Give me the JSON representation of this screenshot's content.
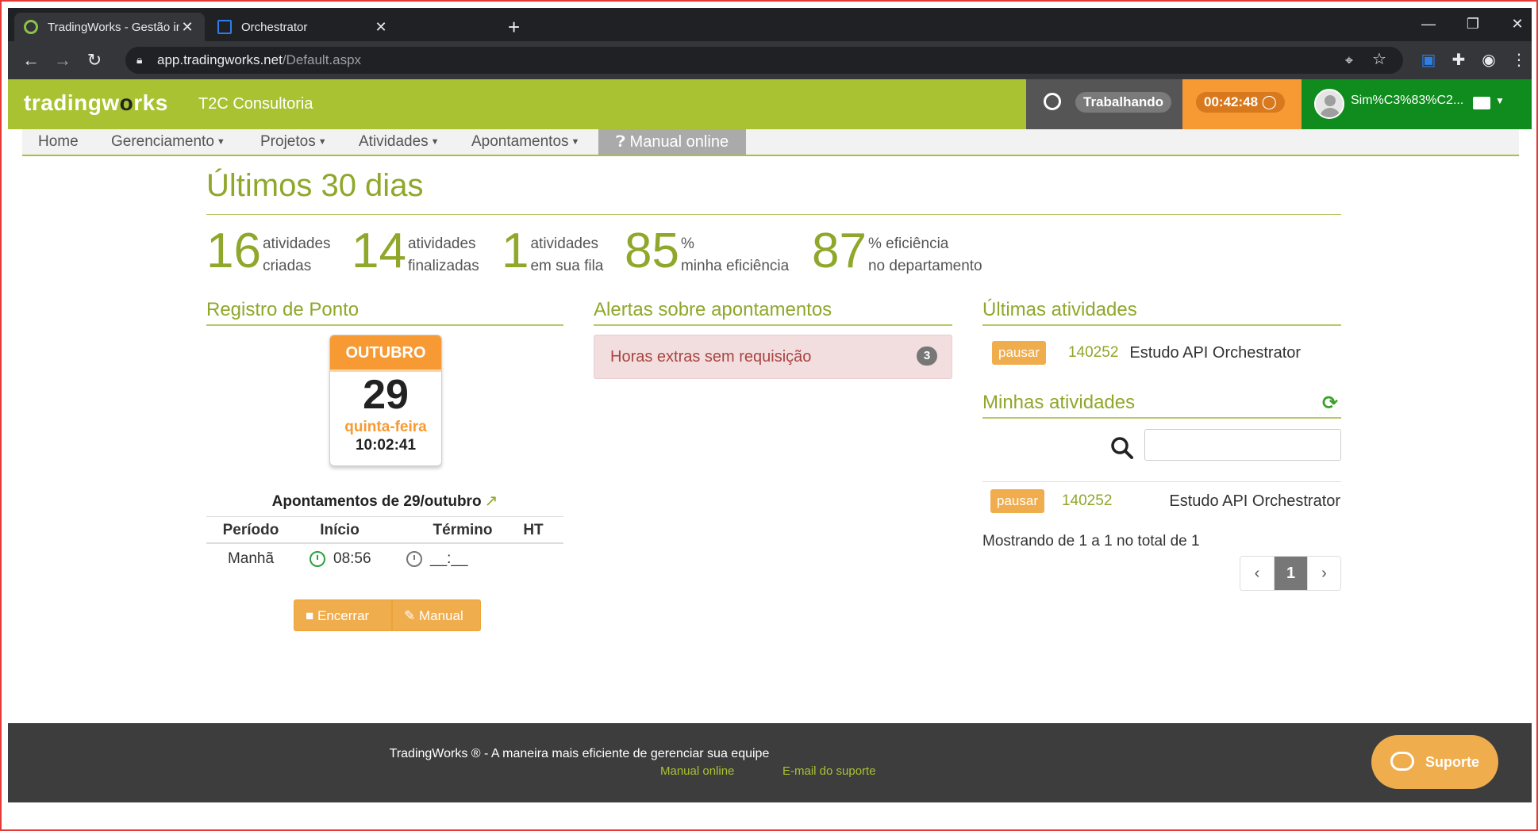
{
  "browser": {
    "tabs": [
      {
        "title": "TradingWorks - Gestão inteligent",
        "close": "✕"
      },
      {
        "title": "Orchestrator",
        "close": "✕"
      }
    ],
    "new_tab": "+",
    "url_domain": "app.tradingworks.net",
    "url_path": "/Default.aspx"
  },
  "header": {
    "logo_a": "trading",
    "logo_b": "w",
    "logo_o": "o",
    "logo_c": "rks",
    "company": "T2C Consultoria",
    "status": "Trabalhando",
    "timer": "00:42:48",
    "username": "Sim%C3%83%C2..."
  },
  "menu": {
    "home": "Home",
    "gerenciamento": "Gerenciamento",
    "projetos": "Projetos",
    "atividades": "Atividades",
    "apontamentos": "Apontamentos",
    "manual": "Manual online"
  },
  "page": {
    "title": "Últimos 30 dias",
    "stats": [
      {
        "num": "16",
        "l1": "atividades",
        "l2": "criadas"
      },
      {
        "num": "14",
        "l1": "atividades",
        "l2": "finalizadas"
      },
      {
        "num": "1",
        "l1": "atividades",
        "l2": "em sua fila"
      },
      {
        "num": "85",
        "l1": "%",
        "l2": "minha eficiência"
      },
      {
        "num": "87",
        "l1": "% eficiência",
        "l2": "no departamento"
      }
    ]
  },
  "ponto": {
    "title": "Registro de Ponto",
    "month": "OUTUBRO",
    "day": "29",
    "weekday": "quinta-feira",
    "time": "10:02:41",
    "apont_title": "Apontamentos de 29/outubro",
    "headers": [
      "Período",
      "Início",
      "Término",
      "HT"
    ],
    "row": {
      "periodo": "Manhã",
      "inicio": "08:56",
      "termino": "__:__",
      "ht": ""
    },
    "btn_encerrar": "Encerrar",
    "btn_manual": "Manual"
  },
  "alertas": {
    "title": "Alertas sobre apontamentos",
    "item": "Horas extras sem requisição",
    "count": "3"
  },
  "ultimas": {
    "title": "Últimas atividades",
    "label": "pausar",
    "id": "140252",
    "name": "Estudo API Orchestrator"
  },
  "minhas": {
    "title": "Minhas atividades",
    "search_placeholder": "",
    "label": "pausar",
    "id": "140252",
    "name": "Estudo API Orchestrator",
    "showing": "Mostrando de 1 a 1 no total de 1",
    "page": "1"
  },
  "footer": {
    "text": "TradingWorks ® - A maneira mais eficiente de gerenciar sua equipe",
    "link1": "Manual online",
    "link2": "E-mail do suporte",
    "support": "Suporte"
  },
  "colors": {
    "brand_green": "#a8c232",
    "accent_orange": "#f79a33",
    "user_green": "#108c1e"
  }
}
